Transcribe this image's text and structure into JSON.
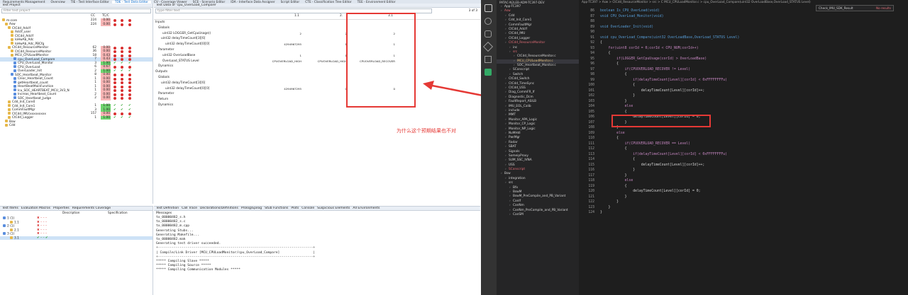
{
  "tabs": [
    "Requirements Management",
    "Overview",
    "TIE - Test Interface Editor",
    "TDE - Test Data Editor",
    "CV - Coverage Viewer",
    "SCE - Scenario Editor",
    "IDA - Interface Data Assigner",
    "Script Editor",
    "CTE - Classification Tree Editor",
    "TEE - Environment Editor"
  ],
  "test_project": {
    "title": "Test Project",
    "filter_placeholder": "Filter test project",
    "cols": [
      "CC",
      "TC/C"
    ],
    "rows": [
      {
        "name": "m-core",
        "cc": "224",
        "cov": "0.00",
        "state": "red"
      },
      {
        "name": "Asw",
        "cc": "224",
        "cov": "0.00",
        "state": "red"
      },
      {
        "name": "CtCdd_AdcIf",
        "cc": "",
        "cov": "",
        "state": ""
      },
      {
        "name": "AdcIf_user",
        "cc": "",
        "cov": "",
        "state": ""
      },
      {
        "name": "CtCdd_AdcIf",
        "cc": "",
        "cov": "",
        "state": ""
      },
      {
        "name": "IoHwAb_Adc",
        "cc": "",
        "cov": "",
        "state": ""
      },
      {
        "name": "IoHwAb_Adc_PBCfg",
        "cc": "",
        "cov": "",
        "state": ""
      },
      {
        "name": "CtCdd_ResourceMonitor",
        "cc": "62",
        "cov": "0.00",
        "state": "red"
      },
      {
        "name": "CtCdd_ResourceMonitor",
        "cc": "36",
        "cov": "0.00",
        "state": "red"
      },
      {
        "name": "MCU_CPULoadMonitor",
        "cc": "18",
        "cov": "0.43",
        "state": "red"
      },
      {
        "name": "cpu_OverLoad_Compare",
        "cc": "7",
        "cov": "0.43",
        "state": "red"
      },
      {
        "name": "CPU_OverLoad_Monitor",
        "cc": "3",
        "cov": "1.00",
        "state": "green"
      },
      {
        "name": "CPU_OverLoad",
        "cc": "6",
        "cov": "0.67",
        "state": "red"
      },
      {
        "name": "OverLoader_Init",
        "cc": "2",
        "cov": "1.00",
        "state": "green"
      },
      {
        "name": "SOC_Heartbeat_Monitor",
        "cc": "8",
        "cov": "0.00",
        "state": "red"
      },
      {
        "name": "Clear_Heartbeat_Count",
        "cc": "1",
        "cov": "0.00",
        "state": "red"
      },
      {
        "name": "getHeartbeat_count",
        "cc": "1",
        "cov": "0.00",
        "state": "red"
      },
      {
        "name": "HeartBeatMainFunction",
        "cc": "1",
        "cov": "0.00",
        "state": "red"
      },
      {
        "name": "Icu_SOC_HEARTBEAT_MCU_3V3_N",
        "cc": "1",
        "cov": "0.00",
        "state": "red"
      },
      {
        "name": "Increas_Heartbeat_Count",
        "cc": "2",
        "cov": "0.00",
        "state": "red"
      },
      {
        "name": "SOC_Heartbeat_Judge",
        "cc": "2",
        "cov": "0.00",
        "state": "red"
      },
      {
        "name": "Cdd_Init_Core0",
        "cc": "",
        "cov": "",
        "state": ""
      },
      {
        "name": "Cdd_Init_Core1",
        "cc": "1",
        "cov": "1.00",
        "state": "green"
      },
      {
        "name": "CommFaultMgr",
        "cc": "3",
        "cov": "1.00",
        "state": "green"
      },
      {
        "name": "CtCdd_IMU(xxxxxxxxx",
        "cc": "157",
        "cov": "0.00",
        "state": "red"
      },
      {
        "name": "CtCdd_Logger",
        "cc": "1",
        "cov": "1.00",
        "state": "green"
      },
      {
        "name": "Bsw",
        "cc": "",
        "cov": "",
        "state": ""
      },
      {
        "name": "Cdd",
        "cc": "",
        "cov": "",
        "state": ""
      }
    ]
  },
  "test_data": {
    "title": "Test Data of 'cpu_OverLoad_Compare'",
    "filter_placeholder": "type filter text",
    "count": "3 of 3",
    "col_headers": [
      "1.1",
      "2.",
      "3.1"
    ],
    "rows": [
      {
        "label": "Inputs",
        "v1": "",
        "v2": "",
        "v3": ""
      },
      {
        "label": "Globals",
        "v1": "",
        "v2": "",
        "v3": ""
      },
      {
        "label": "uint32 LOGGER_GetCpuUsage()",
        "v1": "2",
        "v2": "2",
        "v3": "2"
      },
      {
        "label": "uint32 delayTimeCount[3][6]",
        "v1": "",
        "v2": "",
        "v3": ""
      },
      {
        "label": "uint32 delayTimeCount[0][0]",
        "v1": "4294967295",
        "v2": "1",
        "v3": "1"
      },
      {
        "label": "Parameter",
        "v1": "",
        "v2": "",
        "v3": ""
      },
      {
        "label": "uint32 OverLoadBase",
        "v1": "1",
        "v2": "1",
        "v3": "1"
      },
      {
        "label": "OverLoad_STATUS Level",
        "v1": "CPUOVERLOAD_HIGH",
        "v2": "CPUOVERLOAD_HIGH",
        "v3": "CPUOVERLOAD_RECOVER"
      },
      {
        "label": "Dynamics",
        "v1": "",
        "v2": "",
        "v3": ""
      },
      {
        "label": "Outputs",
        "v1": "",
        "v2": "",
        "v3": ""
      },
      {
        "label": "Globals",
        "v1": "",
        "v2": "",
        "v3": ""
      },
      {
        "label": "uint32 delayTimeCount[3][6]",
        "v1": "",
        "v2": "",
        "v3": ""
      },
      {
        "label": "uint32 delayTimeCount[0][0]",
        "v1": "4294967295",
        "v2": "0",
        "v3": "0"
      },
      {
        "label": "Parameter",
        "v1": "",
        "v2": "",
        "v3": ""
      },
      {
        "label": "Return",
        "v1": "",
        "v2": "",
        "v3": ""
      },
      {
        "label": "Dynamics",
        "v1": "",
        "v2": "",
        "v3": ""
      }
    ]
  },
  "annotation": "为什么这个预期结果也不对",
  "bottom_left": {
    "tabs": [
      "Test Items",
      "Evaluation Macros",
      "Properties",
      "Requirements Coverage"
    ],
    "cols": [
      "Description",
      "Specification"
    ],
    "rows": [
      {
        "name": "1 (1)"
      },
      {
        "name": "1.1"
      },
      {
        "name": "2 (1)"
      },
      {
        "name": "2.1"
      },
      {
        "name": "3 (1)"
      },
      {
        "name": "3.1"
      }
    ]
  },
  "bottom_mid": {
    "tabs": [
      "Test Definition",
      "Call Trace",
      "Declarations/Definitions",
      "Prolog/Epilog",
      "Stub Functions",
      "Plots",
      "Console",
      "Suspicious Elements",
      "All Environments"
    ],
    "label": "Messages",
    "lines": [
      "tx_00000482_s.h",
      "tx_00000482_s.c",
      "tx_00000482_m.cpp",
      "",
      "Generating Stubs...",
      "",
      "Generating Makefile...",
      "tx_00000482.mak",
      "",
      "Generating test driver succeeded.",
      "+-------------------------------------------------------------------------------+",
      "| Compile/Link Driver [MCU_CPULoadMonitor/cpu_OverLoad_Compare]                 |",
      "+-------------------------------------------------------------------------------+",
      "",
      "***** Compiling Slave *****",
      "***** Compiling Source *****",
      "***** Compiling Communication Modules *****"
    ]
  },
  "explorer": {
    "title": "PATAC-N2LEB-ADM-TC397-DEV",
    "items": [
      {
        "d": 1,
        "t": "App-TC397",
        "c": "#d4d4d4"
      },
      {
        "d": 1,
        "t": "Asw",
        "c": "#e06c75"
      },
      {
        "d": 2,
        "t": "Cdd",
        "c": "#d4d4d4"
      },
      {
        "d": 2,
        "t": "Cdd_Init_Core1",
        "c": "#d4d4d4"
      },
      {
        "d": 2,
        "t": "CommFaultMgr",
        "c": "#d4d4d4"
      },
      {
        "d": 2,
        "t": "CtCdd_AdcIf",
        "c": "#d4d4d4"
      },
      {
        "d": 2,
        "t": "CtCdd_IMU",
        "c": "#d4d4d4"
      },
      {
        "d": 2,
        "t": "CtCdd_Logger",
        "c": "#d4d4d4"
      },
      {
        "d": 2,
        "t": "CtCdd_ResourceMonitor",
        "c": "#e06c75"
      },
      {
        "d": 3,
        "t": "inc",
        "c": "#d4d4d4"
      },
      {
        "d": 3,
        "t": "src",
        "c": "#e06c75"
      },
      {
        "d": 4,
        "t": "CtCdd_ResourceMonitor.c",
        "c": "#d4d4d4"
      },
      {
        "d": 4,
        "t": "MCU_CPULoadMonitor.c",
        "c": "#e5c07b",
        "sel": true
      },
      {
        "d": 4,
        "t": "SOC_Heartbeat_Monitor.c",
        "c": "#d4d4d4"
      },
      {
        "d": 3,
        "t": "SConscript",
        "c": "#d4d4d4"
      },
      {
        "d": 3,
        "t": "Switch",
        "c": "#d4d4d4"
      },
      {
        "d": 2,
        "t": "CtCdd_Switch",
        "c": "#d4d4d4"
      },
      {
        "d": 2,
        "t": "CtCdd_TimeSync",
        "c": "#d4d4d4"
      },
      {
        "d": 2,
        "t": "CtCdd_USS",
        "c": "#d4d4d4"
      },
      {
        "d": 2,
        "t": "Diag_CommFR_If",
        "c": "#d4d4d4"
      },
      {
        "d": 2,
        "t": "Diagnostic_Dcm",
        "c": "#d4d4d4"
      },
      {
        "d": 2,
        "t": "FaultReport_ASILB",
        "c": "#d4d4d4"
      },
      {
        "d": 2,
        "t": "IMU_EOL_Calib",
        "c": "#d4d4d4"
      },
      {
        "d": 2,
        "t": "include",
        "c": "#d4d4d4"
      },
      {
        "d": 2,
        "t": "MMT",
        "c": "#d4d4d4"
      },
      {
        "d": 2,
        "t": "Monitor_APA_Logic",
        "c": "#d4d4d4"
      },
      {
        "d": 2,
        "t": "Monitor_CP_Logic",
        "c": "#d4d4d4"
      },
      {
        "d": 2,
        "t": "Monitor_NP_Logic",
        "c": "#d4d4d4"
      },
      {
        "d": 2,
        "t": "NvMHdl",
        "c": "#d4d4d4"
      },
      {
        "d": 2,
        "t": "PwrMgr",
        "c": "#d4d4d4"
      },
      {
        "d": 2,
        "t": "Radar",
        "c": "#d4d4d4"
      },
      {
        "d": 2,
        "t": "SBAT",
        "c": "#d4d4d4"
      },
      {
        "d": 2,
        "t": "Signals",
        "c": "#d4d4d4"
      },
      {
        "d": 2,
        "t": "SomeipProxy",
        "c": "#d4d4d4"
      },
      {
        "d": 2,
        "t": "SUM_SSC_IVNA",
        "c": "#d4d4d4"
      },
      {
        "d": 2,
        "t": "USS",
        "c": "#d4d4d4"
      },
      {
        "d": 2,
        "t": "SConscript",
        "c": "#e06c75"
      },
      {
        "d": 1,
        "t": "Bsw",
        "c": "#d4d4d4"
      },
      {
        "d": 2,
        "t": "integration",
        "c": "#d4d4d4"
      },
      {
        "d": 2,
        "t": "src",
        "c": "#d4d4d4"
      },
      {
        "d": 3,
        "t": "Bfx",
        "c": "#d4d4d4"
      },
      {
        "d": 3,
        "t": "BswM",
        "c": "#d4d4d4"
      },
      {
        "d": 3,
        "t": "BswM_PreCompile_and_PB_Variant",
        "c": "#d4d4d4"
      },
      {
        "d": 3,
        "t": "CanIf",
        "c": "#d4d4d4"
      },
      {
        "d": 3,
        "t": "CanNm",
        "c": "#d4d4d4"
      },
      {
        "d": 3,
        "t": "CanNm_PreCompile_and_PB_Variant",
        "c": "#d4d4d4"
      },
      {
        "d": 3,
        "t": "CanSM",
        "c": "#d4d4d4"
      }
    ]
  },
  "editor": {
    "breadcrumb": "App-TC397 > Asw > CtCdd_ResourceMonitor > src > C MCU_CPULoadMonitor.c > cpu_OverLoad_Compare(uint32 OverLoadBase,OverLoad_STATUS Level)",
    "find": {
      "value": "Check_IMU_SDK_Result",
      "result": "No results"
    },
    "lines": [
      {
        "n": "86",
        "t": "boolean Is_CPU_OverLoad(void)"
      },
      {
        "n": "87",
        "t": "void CPU_OverLoad_Monitor(void)"
      },
      {
        "n": "88",
        "t": ""
      },
      {
        "n": "89",
        "t": "void OverLoader_Init(void)"
      },
      {
        "n": "90",
        "t": ""
      },
      {
        "n": "91",
        "t": "void cpu_OverLoad_Compare(uint32 OverLoadBase,OverLoad_STATUS Level)"
      },
      {
        "n": "92",
        "t": "{"
      },
      {
        "n": "93",
        "t": "    for(uint8 corId = 0;corId < CPU_NUM;corId++)"
      },
      {
        "n": "94",
        "t": "    {"
      },
      {
        "n": "95",
        "t": "        if(LOGGER_GetCpuUsage(corId) > OverLoadBase)"
      },
      {
        "n": "96",
        "t": "        {"
      },
      {
        "n": "97",
        "t": "            if(CPUOVERLOAD_RECOVER != Level)"
      },
      {
        "n": "98",
        "t": "            {"
      },
      {
        "n": "99",
        "t": "                if(delayTimeCount[Level][corId] < 0xFFFFFFFFu)"
      },
      {
        "n": "100",
        "t": "                {"
      },
      {
        "n": "101",
        "t": "                    delayTimeCount[Level][corId]++;"
      },
      {
        "n": "102",
        "t": "                }"
      },
      {
        "n": "103",
        "t": "            }"
      },
      {
        "n": "104",
        "t": "            else"
      },
      {
        "n": "105",
        "t": "            {"
      },
      {
        "n": "106",
        "t": "                delayTimeCount[Level][corId] = 0;"
      },
      {
        "n": "107",
        "t": "            }"
      },
      {
        "n": "108",
        "t": "        }"
      },
      {
        "n": "109",
        "t": "        else"
      },
      {
        "n": "110",
        "t": "        {"
      },
      {
        "n": "111",
        "t": "            if(CPUOVERLOAD_RECOVER == Level)"
      },
      {
        "n": "112",
        "t": "            {"
      },
      {
        "n": "113",
        "t": "                if(delayTimeCount[Level][corId] < 0xFFFFFFFFu)"
      },
      {
        "n": "114",
        "t": "                {"
      },
      {
        "n": "115",
        "t": "                    delayTimeCount[Level][corId]++;"
      },
      {
        "n": "116",
        "t": "                }"
      },
      {
        "n": "117",
        "t": "            }"
      },
      {
        "n": "118",
        "t": "            else"
      },
      {
        "n": "119",
        "t": "            {"
      },
      {
        "n": "120",
        "t": "                delayTimeCount[Level][corId] = 0;"
      },
      {
        "n": "121",
        "t": "            }"
      },
      {
        "n": "122",
        "t": "        }"
      },
      {
        "n": "123",
        "t": "    }"
      },
      {
        "n": "124",
        "t": "}"
      }
    ]
  },
  "colors": {
    "accent_red": "#e53935",
    "coverage_red": "#f7b5b5",
    "coverage_green": "#6fd46f",
    "vscode_bg": "#1e1e1e",
    "sidebar_bg": "#252526"
  }
}
